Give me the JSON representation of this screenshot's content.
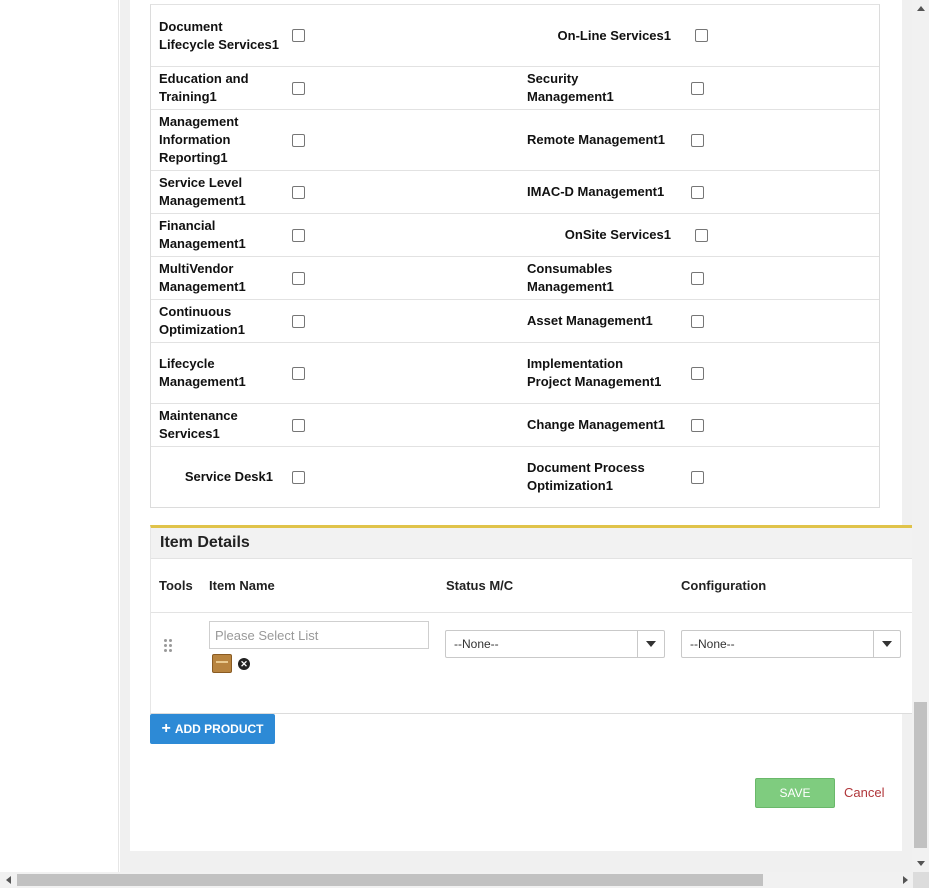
{
  "services": {
    "rows": [
      {
        "left": "Document Lifecycle Services1",
        "right": "On-Line Services1"
      },
      {
        "left": "Education and Training1",
        "right": "Security Management1"
      },
      {
        "left": "Management Information Reporting1",
        "right": "Remote Management1"
      },
      {
        "left": "Service Level Management1",
        "right": "IMAC-D Management1"
      },
      {
        "left": "Financial Management1",
        "right": "OnSite Services1"
      },
      {
        "left": "MultiVendor Management1",
        "right": "Consumables Management1"
      },
      {
        "left": "Continuous Optimization1",
        "right": "Asset Management1"
      },
      {
        "left": "Lifecycle Management1",
        "right": "Implementation Project Management1"
      },
      {
        "left": "Maintenance Services1",
        "right": "Change Management1"
      },
      {
        "left": "Service Desk1",
        "right": "Document Process Optimization1"
      }
    ]
  },
  "item_details": {
    "title": "Item Details",
    "columns": {
      "tools": "Tools",
      "item_name": "Item Name",
      "status": "Status M/C",
      "configuration": "Configuration"
    },
    "item_name_placeholder": "Please Select List",
    "status_value": "--None--",
    "configuration_value": "--None--"
  },
  "actions": {
    "add_product": "ADD PRODUCT",
    "save": "SAVE",
    "cancel": "Cancel"
  },
  "colors": {
    "accent_bar": "#e0c34a",
    "primary_button": "#2d8ad6",
    "save_button": "#7fcc7f",
    "cancel_link": "#b0363a"
  }
}
